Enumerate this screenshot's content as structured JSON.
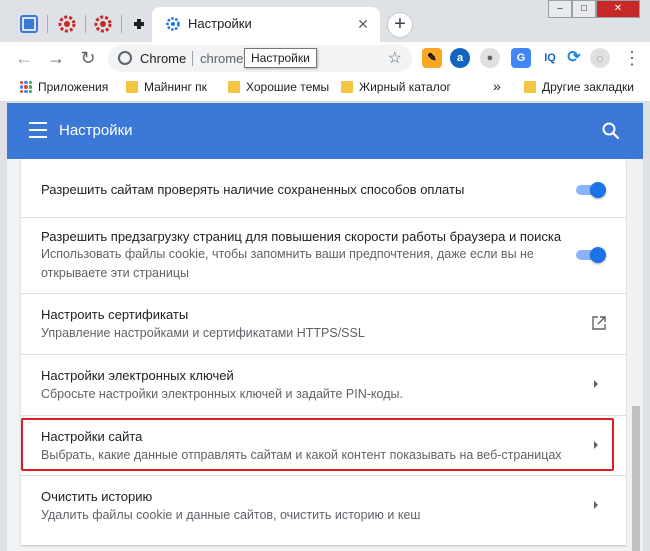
{
  "window": {
    "active_tab_title": "Настройки",
    "close_tab_glyph": "✕",
    "new_tab_glyph": "+",
    "controls": [
      "–",
      "□",
      "✕"
    ]
  },
  "pinned_tabs": [
    {
      "icon": "puzzle-favicon",
      "color": "#3c78d8"
    },
    {
      "icon": "gear-favicon",
      "color": "#c62828"
    },
    {
      "icon": "gear-favicon",
      "color": "#c62828"
    },
    {
      "icon": "plugin-favicon",
      "color": "#202124"
    }
  ],
  "toolbar": {
    "back": "←",
    "forward": "→",
    "reload": "↻",
    "omnibox_chip": "Chrome",
    "omnibox_url": "chrome",
    "bookmark_star": "☆",
    "tooltip": "Настройки",
    "menu_glyph": "⋮"
  },
  "extensions": [
    {
      "icon": "pen-extension-icon",
      "glyph": "✎",
      "bg": "#f9a825",
      "fg": "#000000"
    },
    {
      "icon": "a-extension-icon",
      "glyph": "a",
      "bg": "#1565c0",
      "fg": "#ffffff"
    },
    {
      "icon": "circle-extension-icon",
      "glyph": "●",
      "bg": "#e0e0e0",
      "fg": "#616161"
    },
    {
      "icon": "translate-extension-icon",
      "glyph": "G",
      "bg": "#4285f4",
      "fg": "#ffffff"
    },
    {
      "icon": "iq-extension-icon",
      "glyph": "IQ",
      "bg": "#ffffff",
      "fg": "#1565c0"
    },
    {
      "icon": "sync-extension-icon",
      "glyph": "⟳",
      "bg": "#ffffff",
      "fg": "#1e88e5"
    },
    {
      "icon": "profile-avatar-icon",
      "glyph": "○",
      "bg": "#e0e0e0",
      "fg": "#9aa0a6"
    }
  ],
  "bookmarks": {
    "apps": "Приложения",
    "items": [
      "Майнинг пк",
      "Хорошие темы",
      "Жирный каталог"
    ],
    "overflow": "»",
    "other": "Другие закладки"
  },
  "header": {
    "title": "Настройки",
    "bg_color": "#3c78d8"
  },
  "rows": [
    {
      "primary": "Разрешить сайтам проверять наличие сохраненных способов оплаты",
      "control": "toggle",
      "enabled": true
    },
    {
      "primary": "Разрешить предзагрузку страниц для повышения скорости работы браузера и поиска",
      "secondary": "Использовать файлы cookie, чтобы запомнить ваши предпочтения, даже если вы не открываете эти страницы",
      "control": "toggle",
      "enabled": true
    },
    {
      "primary": "Настроить сертификаты",
      "secondary": "Управление настройками и сертификатами HTTPS/SSL",
      "control": "external"
    },
    {
      "primary": "Настройки электронных ключей",
      "secondary": "Сбросьте настройки электронных ключей и задайте PIN-коды.",
      "control": "arrow"
    },
    {
      "primary": "Настройки сайта",
      "secondary": "Выбрать, какие данные отправлять сайтам и какой контент показывать на веб-страницах",
      "control": "arrow",
      "highlighted": true
    },
    {
      "primary": "Очистить историю",
      "secondary": "Удалить файлы cookie и данные сайтов, очистить историю и кеш",
      "control": "arrow"
    }
  ],
  "colors": {
    "accent": "#1a73e8",
    "highlight": "#e01b24"
  }
}
